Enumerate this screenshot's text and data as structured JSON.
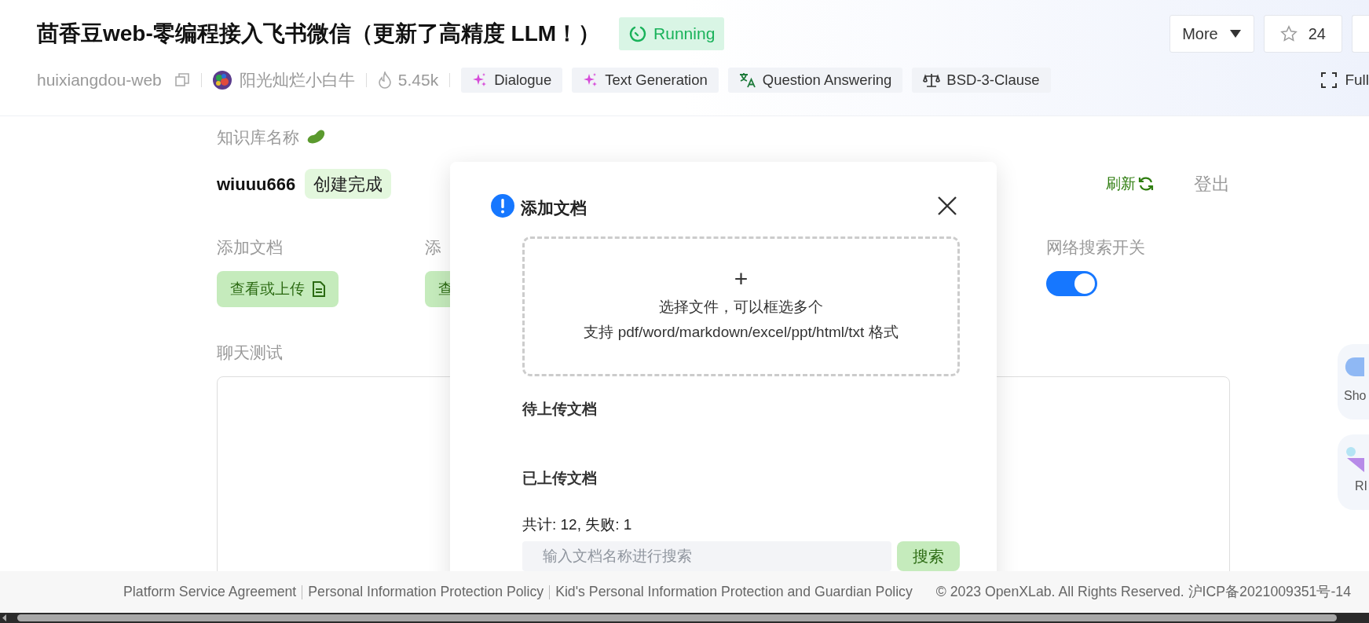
{
  "project": {
    "title": "茴香豆web-零编程接入飞书微信（更新了高精度 LLM！）",
    "status": {
      "label": "Running",
      "kind": "running"
    },
    "repo": "huixiangdou-web",
    "author": "阳光灿烂小白牛",
    "heat": "5.45k",
    "tags": [
      {
        "label": "Dialogue",
        "kind": "sparkle"
      },
      {
        "label": "Text Generation",
        "kind": "sparkle"
      },
      {
        "label": "Question Answering",
        "kind": "translate"
      },
      {
        "label": "BSD-3-Clause",
        "kind": "license"
      }
    ],
    "actions": {
      "more": "More",
      "stars": "24",
      "fullscreen": "Full"
    }
  },
  "knowledge_base": {
    "label": "知识库名称",
    "name": "wiuuu666",
    "status": "创建完成",
    "refresh": "刷新",
    "logout": "登出"
  },
  "sections": [
    {
      "label": "添加文档",
      "kind": "button",
      "button": "查看或上传"
    },
    {
      "label": "添",
      "kind": "button",
      "button": "查"
    },
    {
      "label": "网络搜索开关",
      "kind": "toggle",
      "on": true
    }
  ],
  "chat": {
    "label": "聊天测试"
  },
  "side_cards": [
    {
      "label": "Sho",
      "kind": "cloud"
    },
    {
      "label": "RI",
      "kind": "gem"
    }
  ],
  "dialog": {
    "title": "添加文档",
    "dropzone": {
      "symbol": "+",
      "line1": "选择文件，可以框选多个",
      "line2": "支持 pdf/word/markdown/excel/ppt/html/txt 格式"
    },
    "pending_heading": "待上传文档",
    "uploaded_heading": "已上传文档",
    "summary": "共计: 12, 失败: 1",
    "search": {
      "placeholder": "输入文档名称进行搜索",
      "button": "搜索"
    }
  },
  "footer": {
    "links": [
      "Platform Service Agreement",
      "Personal Information Protection Policy",
      "Kid's Personal Information Protection and Guardian Policy"
    ],
    "copyright": "© 2023 OpenXLab. All Rights Reserved. 沪ICP备2021009351号-14"
  }
}
